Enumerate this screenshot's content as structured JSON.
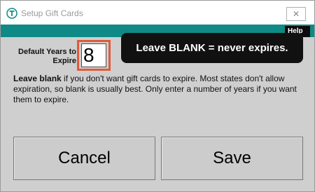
{
  "window": {
    "title": "Setup Gift Cards",
    "close_glyph": "✕",
    "icon": "app-logo-icon"
  },
  "toolbar": {
    "help_label": "Help"
  },
  "field": {
    "label": "Default Years to Expire",
    "value": "8"
  },
  "tooltip": {
    "text": "Leave BLANK = never expires."
  },
  "description": {
    "lead": "Leave blank",
    "body": " if you don't want gift cards to expire. Most states don't allow expiration, so blank is usually best. Only enter a number of years if you want them to expire."
  },
  "buttons": {
    "cancel_label": "Cancel",
    "save_label": "Save"
  },
  "colors": {
    "teal": "#0f8a86",
    "highlight": "#e05a3a",
    "tooltip_bg": "#111111"
  }
}
